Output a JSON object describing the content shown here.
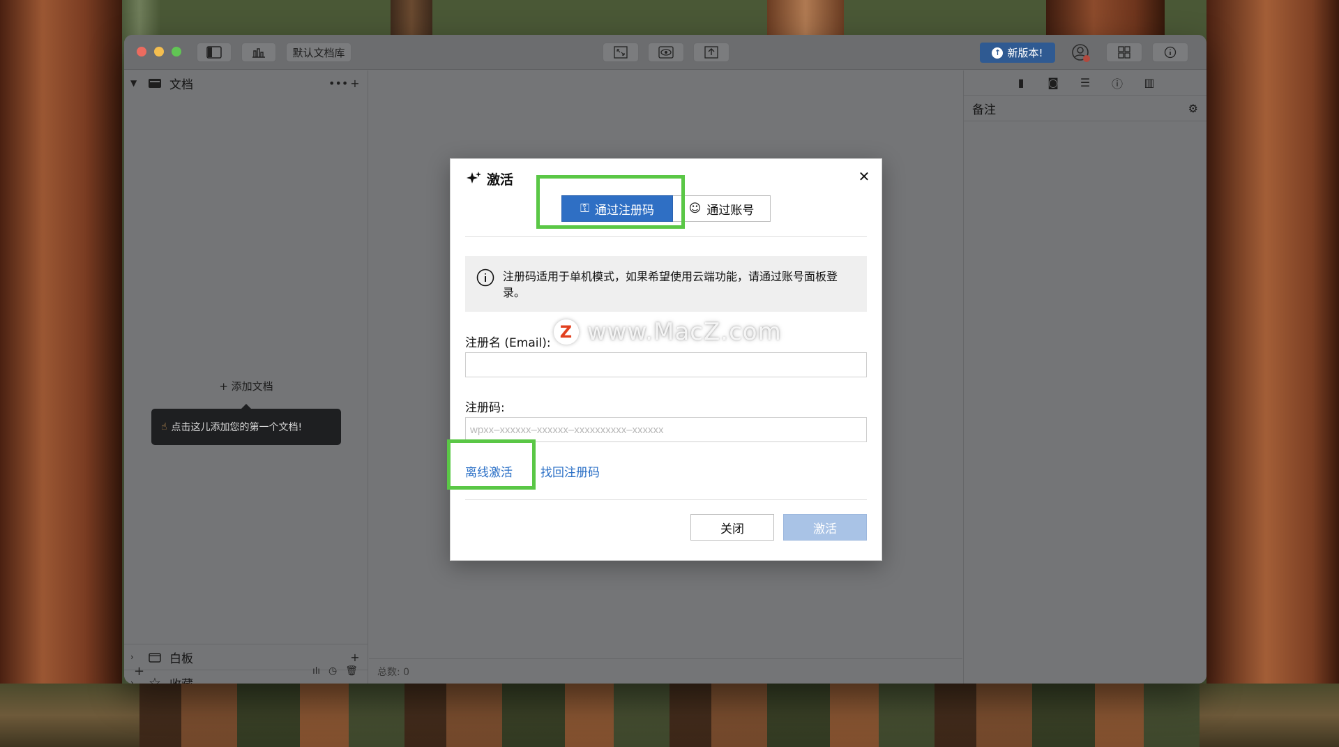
{
  "window": {
    "library_label": "默认文档库",
    "update_label": "新版本!"
  },
  "sidebar": {
    "documents_label": "文档",
    "add_document_label": "添加文档",
    "tooltip_text": "点击这儿添加您的第一个文档!",
    "whiteboard_label": "白板",
    "favorites_label": "收藏"
  },
  "main": {
    "status_text": "总数: 0"
  },
  "right_panel": {
    "header_label": "备注"
  },
  "dialog": {
    "title": "激活",
    "tab_code_label": "通过注册码",
    "tab_account_label": "通过账号",
    "notice_text": "注册码适用于单机模式，如果希望使用云端功能，请通过账号面板登录。",
    "email_label": "注册名 (Email):",
    "email_value": "",
    "code_label": "注册码:",
    "code_placeholder": "wpxx–xxxxxx–xxxxxx–xxxxxxxxxx–xxxxxx",
    "offline_link": "离线激活",
    "retrieve_link": "找回注册码",
    "close_button": "关闭",
    "activate_button": "激活"
  },
  "watermark": {
    "logo_letter": "Z",
    "text": "www.MacZ.com"
  },
  "colors": {
    "accent": "#2f6fc4",
    "highlight_box": "#5ac746",
    "link": "#2a6fc6",
    "disabled_button": "#a9c3e6"
  }
}
